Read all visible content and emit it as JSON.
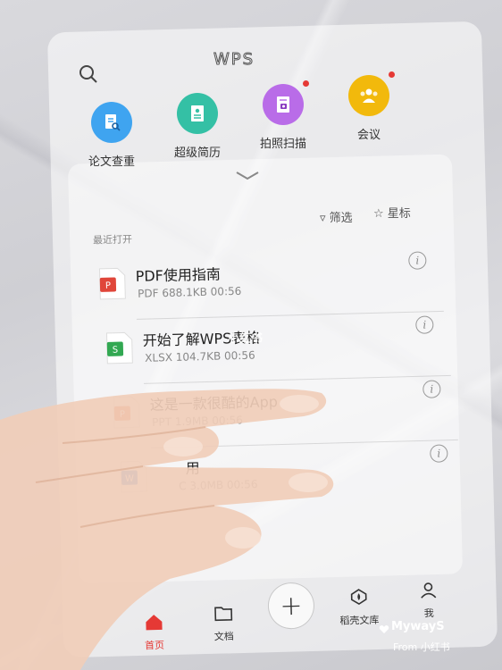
{
  "header": {
    "logo_text": "WPS"
  },
  "apps": [
    {
      "label": "论文查重",
      "icon": "document-search-icon",
      "color": "#3fa4f0",
      "badge": false
    },
    {
      "label": "超级简历",
      "icon": "resume-icon",
      "color": "#34c0a5",
      "badge": false
    },
    {
      "label": "拍照扫描",
      "icon": "camera-scan-icon",
      "color": "#b96ce8",
      "badge": true
    },
    {
      "label": "会议",
      "icon": "meeting-icon",
      "color": "#f2b90c",
      "badge": true
    }
  ],
  "filters": {
    "filter_label": "筛选",
    "star_label": "星标"
  },
  "recent_label": "最近打开",
  "files": [
    {
      "name": "PDF使用指南",
      "type": "PDF",
      "size": "688.1KB",
      "time": "00:56",
      "color": "#e0463a"
    },
    {
      "name": "开始了解WPS表格",
      "type": "XLSX",
      "size": "104.7KB",
      "time": "00:56",
      "color": "#32a852"
    },
    {
      "name": "这是一款很酷的App",
      "type": "PPT",
      "size": "1.9MB",
      "time": "00:56",
      "color": "#e8643a"
    },
    {
      "name": "用",
      "type": "C",
      "size": "3.0MB",
      "time": "00:56",
      "color": "#3a7ee0"
    }
  ],
  "nav": [
    {
      "label": "首页",
      "icon": "home-icon",
      "active": true
    },
    {
      "label": "文档",
      "icon": "folder-icon",
      "active": false
    },
    {
      "label": "稻壳文库",
      "icon": "docer-icon",
      "active": false
    },
    {
      "label": "我",
      "icon": "user-icon",
      "active": false
    }
  ],
  "plus_symbol": "+",
  "watermark": {
    "center": "小红书",
    "name": "MywayS",
    "from": "From 小红书"
  },
  "colors": {
    "accent": "#e53935",
    "active_nav": "#e53935"
  }
}
